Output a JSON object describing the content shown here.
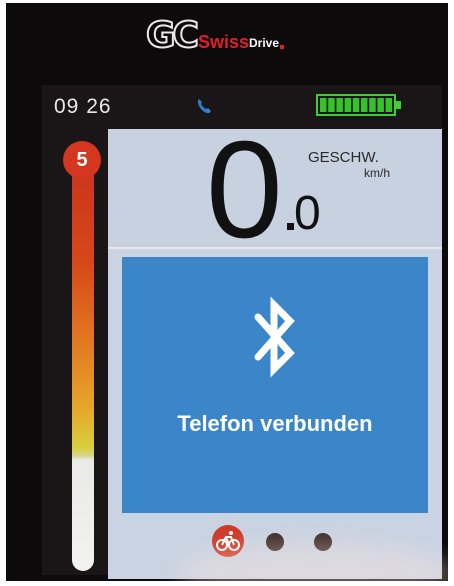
{
  "brand": {
    "mark": "GC",
    "swiss": "Swiss",
    "drive": "Drive"
  },
  "status_bar": {
    "time": "09 26",
    "phone_icon": "phone-icon",
    "battery_icon": "battery-icon",
    "battery_level": 1.0
  },
  "assist": {
    "level": "5",
    "fill_fraction": 0.72
  },
  "speed": {
    "integer": "0",
    "decimal": "0",
    "label": "GESCHW.",
    "unit": "km/h"
  },
  "notification": {
    "icon": "bluetooth-icon",
    "message": "Telefon verbunden"
  },
  "page_indicator": {
    "active_icon": "bicycle-icon",
    "pages": 3,
    "active_index": 0
  },
  "colors": {
    "accent_red": "#cf3a2a",
    "panel_blue": "#3a86c8",
    "battery_green": "#35c22b"
  }
}
